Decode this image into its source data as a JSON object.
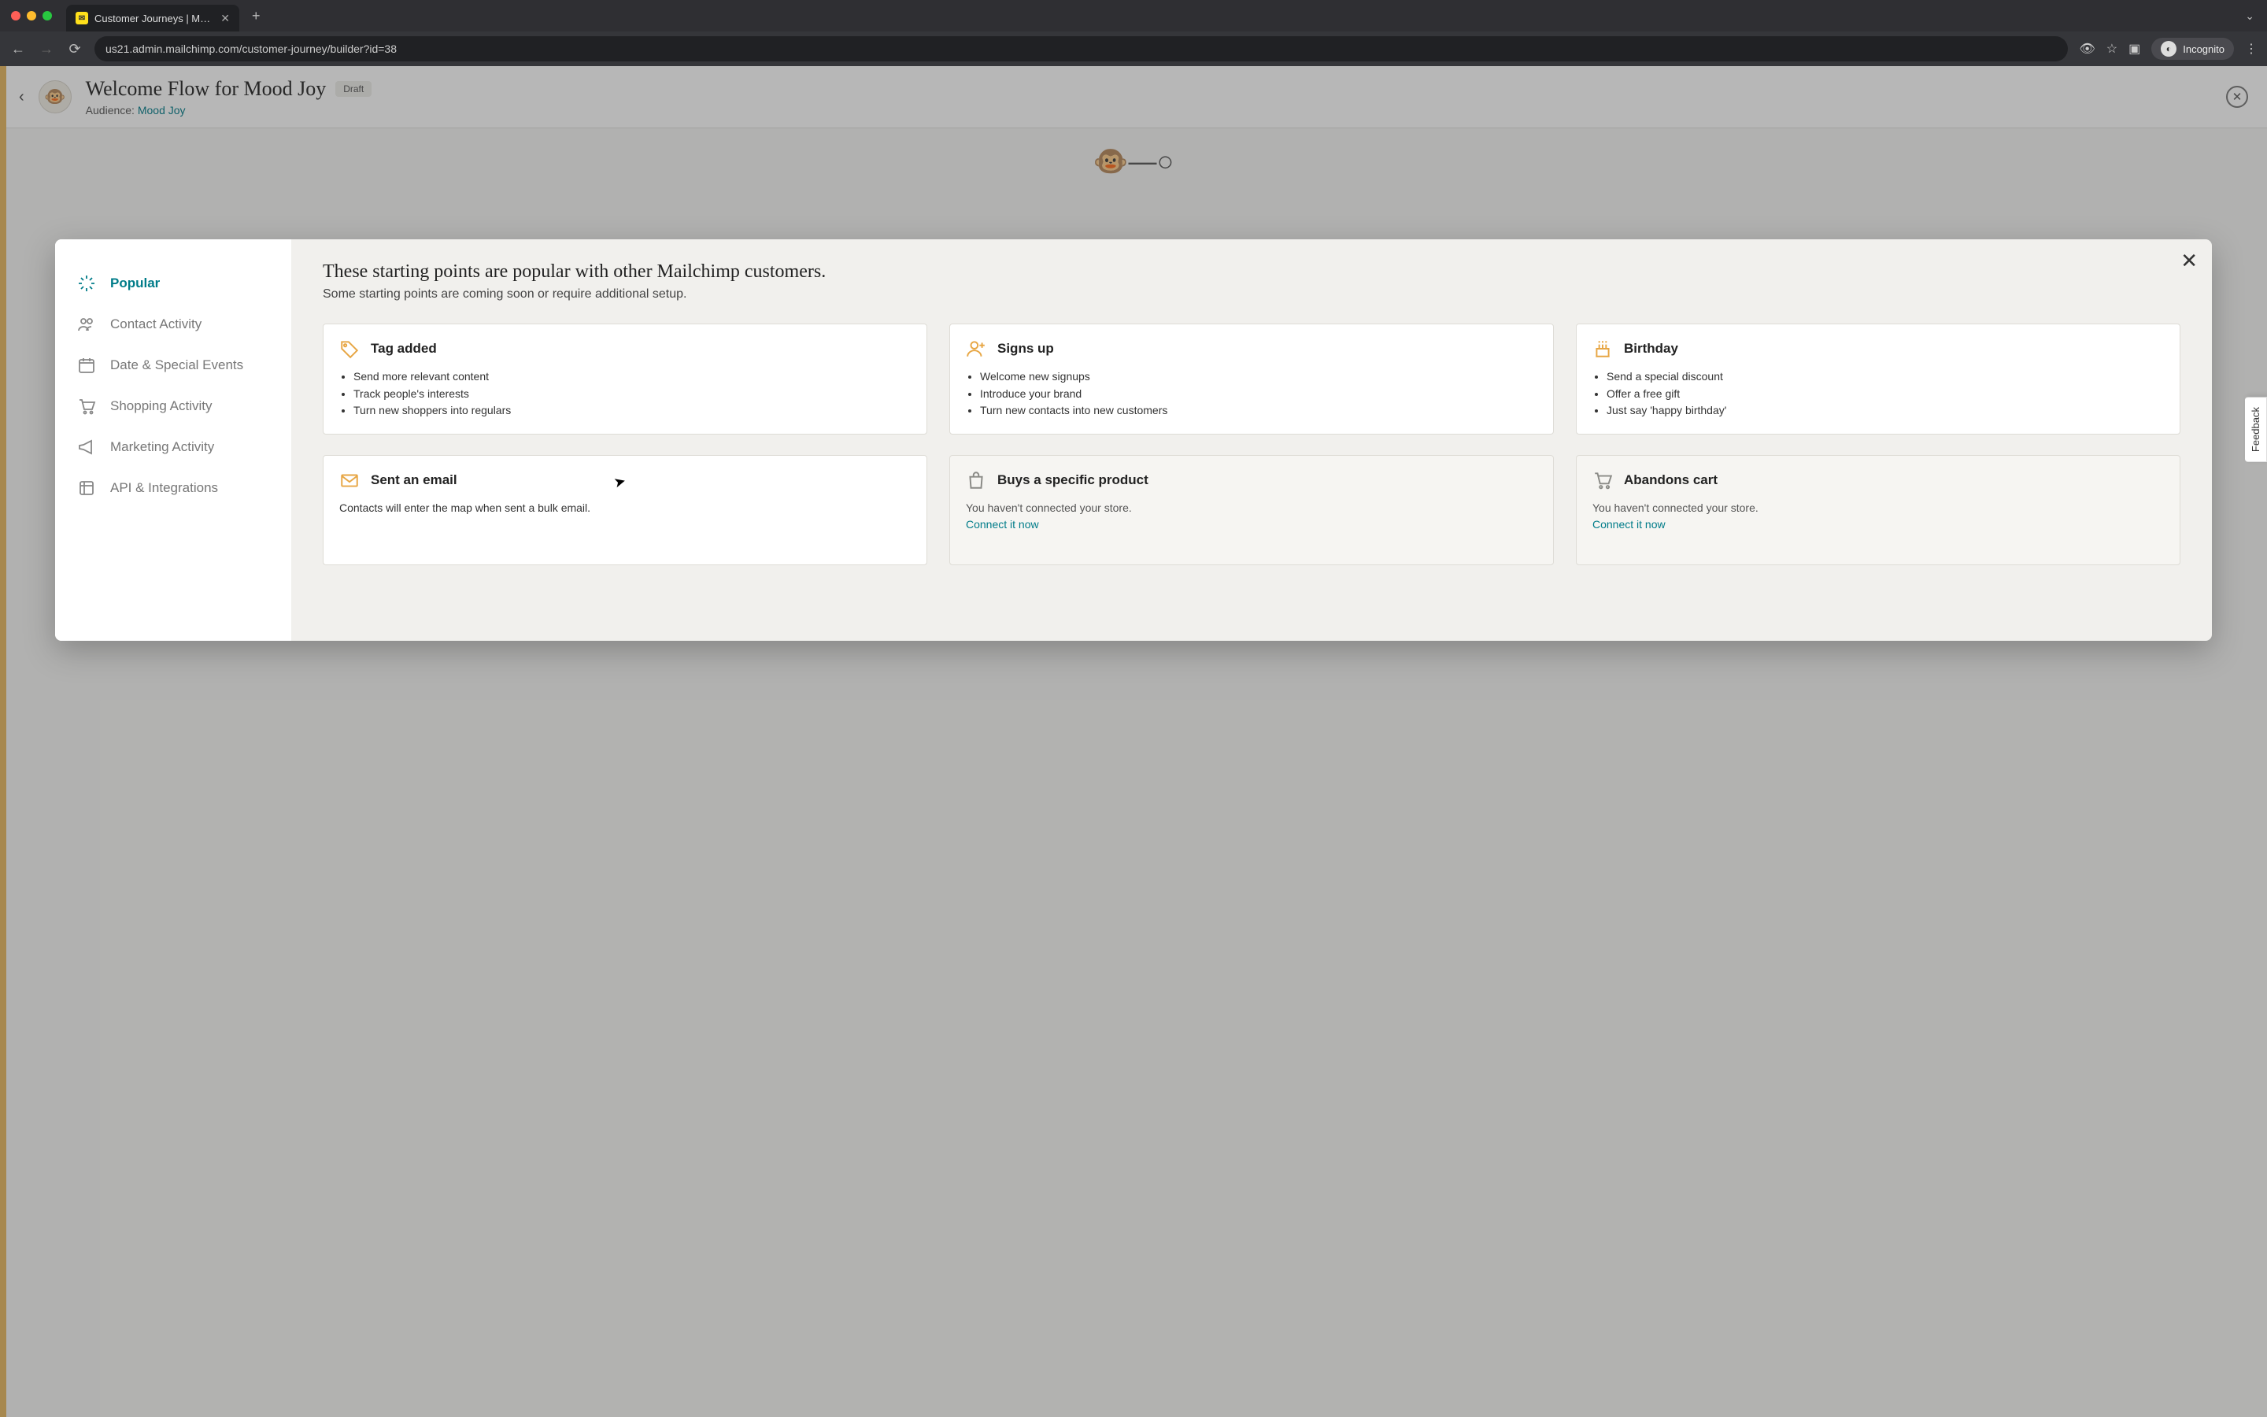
{
  "browser": {
    "tab_title": "Customer Journeys | Mailchimp",
    "url": "us21.admin.mailchimp.com/customer-journey/builder?id=38",
    "incognito_label": "Incognito"
  },
  "header": {
    "title": "Welcome Flow for Mood Joy",
    "status_badge": "Draft",
    "audience_label": "Audience: ",
    "audience_name": "Mood Joy"
  },
  "sidebar": {
    "items": [
      {
        "label": "Popular",
        "icon": "sparkle"
      },
      {
        "label": "Contact Activity",
        "icon": "people"
      },
      {
        "label": "Date & Special Events",
        "icon": "calendar"
      },
      {
        "label": "Shopping Activity",
        "icon": "cart"
      },
      {
        "label": "Marketing Activity",
        "icon": "megaphone"
      },
      {
        "label": "API & Integrations",
        "icon": "api"
      }
    ]
  },
  "modal": {
    "heading": "These starting points are popular with other Mailchimp customers.",
    "subheading": "Some starting points are coming soon or require additional setup."
  },
  "cards": [
    {
      "title": "Tag added",
      "icon": "tag",
      "bullets": [
        "Send more relevant content",
        "Track people's interests",
        "Turn new shoppers into regulars"
      ],
      "muted": false
    },
    {
      "title": "Signs up",
      "icon": "person-plus",
      "bullets": [
        "Welcome new signups",
        "Introduce your brand",
        "Turn new contacts into new customers"
      ],
      "muted": false
    },
    {
      "title": "Birthday",
      "icon": "cake",
      "bullets": [
        "Send a special discount",
        "Offer a free gift",
        "Just say 'happy birthday'"
      ],
      "muted": false
    },
    {
      "title": "Sent an email",
      "icon": "envelope",
      "desc": "Contacts will enter the map when sent a bulk email.",
      "muted": false
    },
    {
      "title": "Buys a specific product",
      "icon": "bag",
      "desc": "You haven't connected your store.",
      "link": "Connect it now",
      "muted": true
    },
    {
      "title": "Abandons cart",
      "icon": "cart",
      "desc": "You haven't connected your store.",
      "link": "Connect it now",
      "muted": true
    }
  ],
  "feedback_label": "Feedback"
}
